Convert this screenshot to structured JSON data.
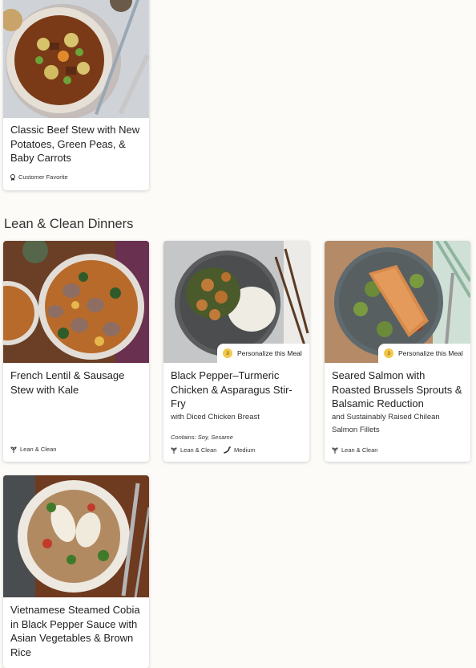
{
  "section": {
    "title": "Lean & Clean Dinners"
  },
  "cards": [
    {
      "title": "Classic Beef Stew with New Potatoes, Green Peas, & Baby Carrots",
      "tags": [
        "Customer Favorite"
      ]
    },
    {
      "title": "French Lentil & Sausage Stew with Kale",
      "tags": [
        "Lean & Clean"
      ]
    },
    {
      "title": "Black Pepper–Turmeric Chicken & Asparagus Stir-Fry",
      "subtitle": "with Diced Chicken Breast",
      "contains": "Contains: Soy, Sesame",
      "personalize": {
        "count": "3",
        "label": "Personalize this Meal"
      },
      "tags": [
        "Lean & Clean",
        "Medium"
      ]
    },
    {
      "title": "Seared Salmon with Roasted Brussels Sprouts & Balsamic Reduction",
      "subtitle": "and Sustainably Raised Chilean Salmon Fillets",
      "personalize": {
        "count": "3",
        "label": "Personalize this Meal"
      },
      "tags": [
        "Lean & Clean"
      ]
    },
    {
      "title": "Vietnamese Steamed Cobia in Black Pepper Sauce with Asian Vegetables & Brown Rice"
    }
  ],
  "icons": {
    "favorite": "ribbon-icon",
    "lean_clean": "sprout-icon",
    "spice": "chili-pepper-icon",
    "coin": "coin-icon"
  },
  "colors": {
    "background": "#fcfbf8",
    "coin": "#f2c94c",
    "text": "#222222"
  }
}
